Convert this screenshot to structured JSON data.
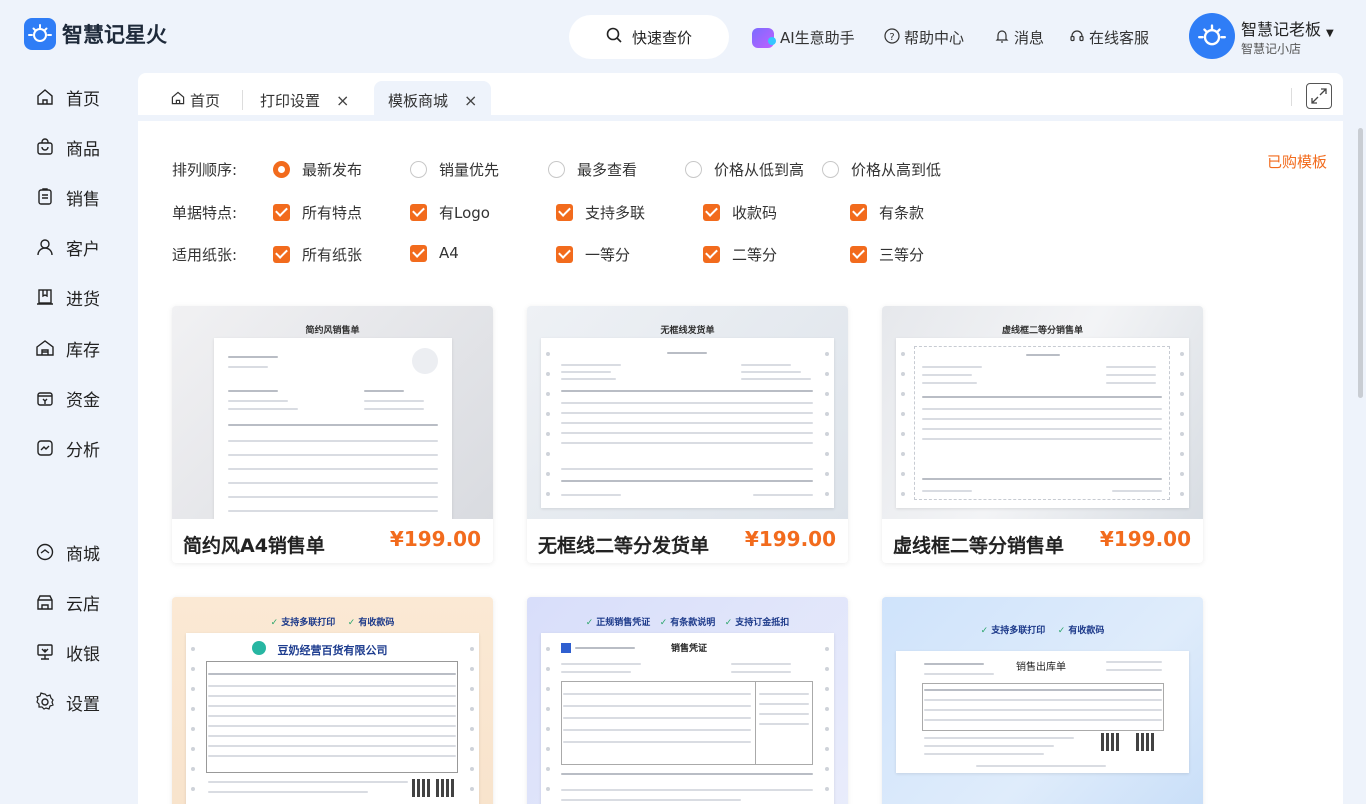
{
  "app": {
    "name": "智慧记星火"
  },
  "header": {
    "quick_price": "快速查价",
    "ai_assistant": "AI生意助手",
    "help": "帮助中心",
    "messages": "消息",
    "support": "在线客服",
    "user_name": "智慧记老板",
    "shop_name": "智慧记小店"
  },
  "sidebar": {
    "items": [
      {
        "label": "首页",
        "icon": "home-icon"
      },
      {
        "label": "商品",
        "icon": "bag-icon"
      },
      {
        "label": "销售",
        "icon": "receipt-icon"
      },
      {
        "label": "客户",
        "icon": "user-icon"
      },
      {
        "label": "进货",
        "icon": "purchase-icon"
      },
      {
        "label": "库存",
        "icon": "warehouse-icon"
      },
      {
        "label": "资金",
        "icon": "wallet-icon"
      },
      {
        "label": "分析",
        "icon": "chart-icon"
      },
      {
        "label": "商城",
        "icon": "mall-icon"
      },
      {
        "label": "云店",
        "icon": "store-icon"
      },
      {
        "label": "收银",
        "icon": "cashier-icon"
      },
      {
        "label": "设置",
        "icon": "settings-icon"
      }
    ]
  },
  "tabs": {
    "home": "首页",
    "print_settings": "打印设置",
    "template_mall": "模板商城",
    "close": "×"
  },
  "filters": {
    "sort_label": "排列顺序:",
    "sort_options": [
      "最新发布",
      "销量优先",
      "最多查看",
      "价格从低到高",
      "价格从高到低"
    ],
    "sort_selected": "最新发布",
    "feature_label": "单据特点:",
    "feature_options": [
      "所有特点",
      "有Logo",
      "支持多联",
      "收款码",
      "有条款"
    ],
    "paper_label": "适用纸张:",
    "paper_options": [
      "所有纸张",
      "A4",
      "一等分",
      "二等分",
      "三等分"
    ],
    "bought": "已购模板"
  },
  "templates": [
    {
      "name": "简约风A4销售单",
      "price": "¥199.00",
      "preview_title": "简约风销售单"
    },
    {
      "name": "无框线二等分发货单",
      "price": "¥199.00",
      "preview_title": "无框线发货单"
    },
    {
      "name": "虚线框二等分销售单",
      "price": "¥199.00",
      "preview_title": "虚线框二等分销售单"
    },
    {
      "badges": [
        "支持多联打印",
        "有收款码"
      ],
      "company": "豆奶经营百货有限公司"
    },
    {
      "badges": [
        "正规销售凭证",
        "有条款说明",
        "支持订金抵扣"
      ],
      "doc_title": "销售凭证"
    },
    {
      "badges": [
        "支持多联打印",
        "有收款码"
      ],
      "doc_title": "销售出库单"
    }
  ],
  "colors": {
    "accent": "#f26b1d",
    "brand": "#2f7df6",
    "background": "#eef3fb"
  }
}
